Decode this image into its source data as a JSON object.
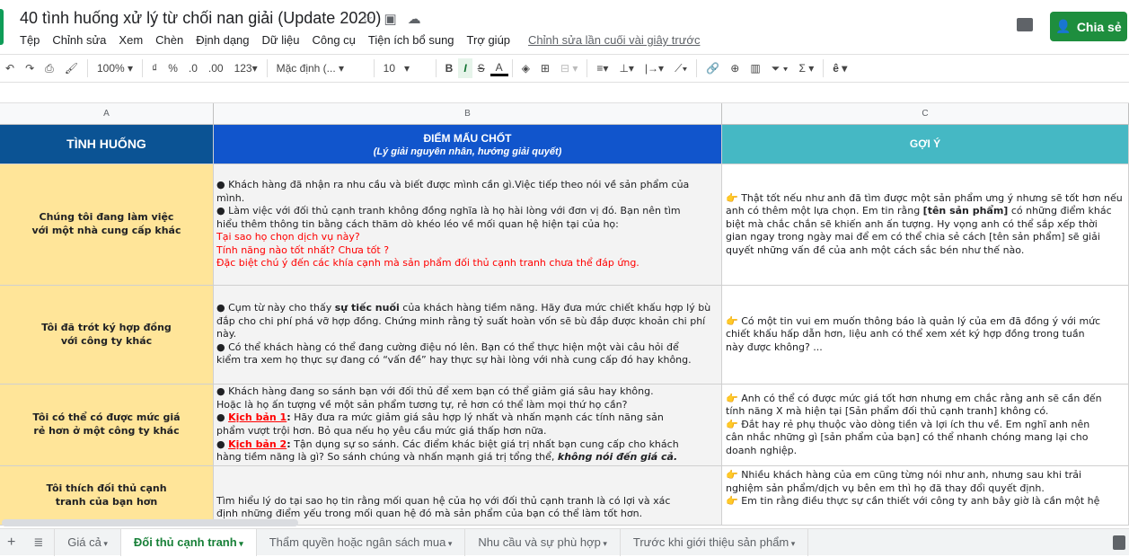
{
  "doc": {
    "title": "40 tình huống xử lý từ chối nan giải (Update 2020)",
    "share_label": "Chia sẻ",
    "last_edit": "Chỉnh sửa lần cuối vài giây trước"
  },
  "menu": [
    "Tệp",
    "Chỉnh sửa",
    "Xem",
    "Chèn",
    "Định dạng",
    "Dữ liệu",
    "Công cụ",
    "Tiện ích bổ sung",
    "Trợ giúp"
  ],
  "toolbar": {
    "zoom": "100%",
    "currency": "₫",
    "percent": "%",
    "dec_less": ".0",
    "dec_more": ".00",
    "format": "123",
    "font": "Mặc định (...",
    "font_size": "10",
    "bold": "B",
    "italic": "I",
    "strike": "S",
    "text_color": "A",
    "input_tool": "ê"
  },
  "columns": [
    "A",
    "B",
    "C"
  ],
  "header": {
    "a": "TÌNH HUỐNG",
    "b_title": "ĐIỂM MẤU CHỐT",
    "b_sub": "(Lý giải nguyên nhân, hướng giải quyết)",
    "c": "GỢI Ý"
  },
  "rows": [
    {
      "a": [
        "Chúng tôi đang làm việc",
        "với một nhà cung cấp khác"
      ],
      "b": [
        [
          {
            "t": "● Khách hàng đã nhận ra nhu cầu và biết được mình cần gì.Việc tiếp theo nói về sản phẩm của mình."
          }
        ],
        [
          {
            "t": "● Làm việc với đối thủ cạnh tranh không đồng nghĩa là họ hài lòng với đơn vị đó. Bạn nên tìm"
          }
        ],
        [
          {
            "t": "hiểu thêm thông tin bằng cách thăm dò khéo léo về mối quan hệ hiện tại của họ:"
          }
        ],
        [
          {
            "t": "Tại sao họ chọn dịch vụ này?",
            "s": "red"
          }
        ],
        [
          {
            "t": "Tính năng nào tốt nhất? Chưa tốt ?",
            "s": "red"
          }
        ],
        [
          {
            "t": "Đặc biệt chú ý đến các khía cạnh mà sản phẩm đối thủ cạnh tranh chưa thể đáp ứng.",
            "s": "red"
          }
        ]
      ],
      "c": [
        [
          {
            "t": "👉 ",
            "s": "hand"
          },
          {
            "t": "Thật tốt nếu như anh đã tìm được một sản phẩm ưng ý nhưng sẽ tốt hơn nếu"
          }
        ],
        [
          {
            "t": "anh có thêm một lựa chọn. Em tin rằng "
          },
          {
            "t": "[tên sản phẩm]",
            "s": "b"
          },
          {
            "t": " có những điểm khác"
          }
        ],
        [
          {
            "t": "biệt mà chắc chắn sẽ khiến anh ấn tượng. Hy vọng anh có thể sắp xếp thời"
          }
        ],
        [
          {
            "t": "gian ngay trong ngày mai để em có thể chia sẻ cách [tên sản phẩm] sẽ giải"
          }
        ],
        [
          {
            "t": "quyết những vấn đề của anh một cách sắc bén như thế nào."
          }
        ]
      ]
    },
    {
      "a": [
        "Tôi đã trót ký hợp đồng",
        "với công ty khác"
      ],
      "b": [
        [
          {
            "t": "● Cụm từ này cho thấy "
          },
          {
            "t": "sự tiếc nuối",
            "s": "b"
          },
          {
            "t": " của khách hàng tiềm năng. Hãy đưa mức chiết khấu hợp lý bù"
          }
        ],
        [
          {
            "t": "đắp cho chi phí phá vỡ hợp đồng. Chứng minh rằng tỷ suất hoàn vốn sẽ bù đắp được khoản chi phí này."
          }
        ],
        [
          {
            "t": "● Có thể khách hàng có thể đang cường điệu nó lên. Bạn có thể thực hiện một vài câu hỏi để"
          }
        ],
        [
          {
            "t": "kiểm tra xem họ thực sự đang có “vấn đề” hay thực sự hài lòng với nhà cung cấp đó hay không."
          }
        ]
      ],
      "c": [
        [
          {
            "t": "👉 ",
            "s": "hand"
          },
          {
            "t": "Có một tin vui em muốn thông báo là quản lý của em đã đồng ý với mức"
          }
        ],
        [
          {
            "t": "chiết khấu hấp dẫn hơn, liệu anh có thể xem xét ký hợp đồng trong tuần"
          }
        ],
        [
          {
            "t": "này được không? ..."
          }
        ]
      ]
    },
    {
      "a": [
        "Tôi có thể có được mức giá",
        "rẻ hơn ở một công ty khác"
      ],
      "b": [
        [
          {
            "t": "● Khách hàng đang so sánh bạn với đối thủ để xem bạn có thể giảm giá sâu hay không."
          }
        ],
        [
          {
            "t": "Hoặc là họ ấn tượng về một sản phẩm tương tự, rẻ hơn có thể làm mọi thứ họ cần?"
          }
        ],
        [
          {
            "t": "● "
          },
          {
            "t": "Kịch bản 1",
            "s": "ul"
          },
          {
            "t": ":",
            "s": "b"
          },
          {
            "t": " Hãy đưa ra mức giảm giá sâu hợp lý nhất và nhấn mạnh các tính năng sản"
          }
        ],
        [
          {
            "t": "phẩm vượt trội hơn. Bỏ qua nếu họ yêu cầu mức giá thấp hơn nữa."
          }
        ],
        [
          {
            "t": "● "
          },
          {
            "t": "Kịch bản 2",
            "s": "ul"
          },
          {
            "t": ":",
            "s": "b"
          },
          {
            "t": " Tận dụng sự so sánh. Các điểm khác biệt giá trị nhất bạn cung cấp cho khách"
          }
        ],
        [
          {
            "t": "hàng tiềm năng là gì? So sánh chúng và nhấn mạnh giá trị tổng thể, "
          },
          {
            "t": "không nói đến giá cả.",
            "s": "bi"
          }
        ]
      ],
      "c": [
        [
          {
            "t": "👉 ",
            "s": "hand"
          },
          {
            "t": "Anh có thể có được mức giá tốt hơn nhưng em chắc rằng anh sẽ cần đến"
          }
        ],
        [
          {
            "t": "tính năng X mà hiện tại [Sản phẩm đối thủ cạnh tranh] không có."
          }
        ],
        [
          {
            "t": " "
          }
        ],
        [
          {
            "t": "👉 ",
            "s": "hand"
          },
          {
            "t": "Đắt hay rẻ phụ thuộc vào dòng tiền và lợi ích thu về. Em nghĩ anh nên"
          }
        ],
        [
          {
            "t": "cân nhắc những gì [sản phẩm của bạn] có thể nhanh chóng mang lại cho"
          }
        ],
        [
          {
            "t": "doanh nghiệp."
          }
        ]
      ]
    },
    {
      "a": [
        "Tôi thích đối thủ cạnh",
        "tranh của bạn hơn"
      ],
      "b": [
        [
          {
            "t": "Tìm hiểu lý do tại sao họ tin rằng mối quan hệ của họ với đối thủ cạnh tranh là có lợi và xác"
          }
        ],
        [
          {
            "t": "định những điểm yếu trong mối quan hệ đó mà sản phẩm của bạn có thể làm tốt hơn."
          }
        ]
      ],
      "c": [
        [
          {
            "t": "👉 ",
            "s": "hand"
          },
          {
            "t": "Nhiều khách hàng của em cũng từng nói như anh, nhưng sau khi trải"
          }
        ],
        [
          {
            "t": "nghiệm sản phẩm/dịch vụ bên em thì họ đã thay đổi quyết định."
          }
        ],
        [
          {
            "t": " "
          }
        ],
        [
          {
            "t": "👉 ",
            "s": "hand"
          },
          {
            "t": "Em tin rằng điều thực sự cần thiết với công ty anh bây giờ là cần một hệ"
          }
        ]
      ]
    }
  ],
  "sheets": [
    {
      "label": "Giá cả",
      "active": false
    },
    {
      "label": "Đối thủ cạnh tranh",
      "active": true
    },
    {
      "label": "Thẩm quyền hoặc ngân sách mua",
      "active": false
    },
    {
      "label": "Nhu cầu và sự phù hợp",
      "active": false
    },
    {
      "label": "Trước khi giới thiệu sản phẩm",
      "active": false
    }
  ],
  "colors": {
    "header_a": "#0b5394",
    "header_b": "#1155cc",
    "header_c": "#45b8c4",
    "situation_bg": "#ffe599",
    "share": "#1e8e3e"
  }
}
